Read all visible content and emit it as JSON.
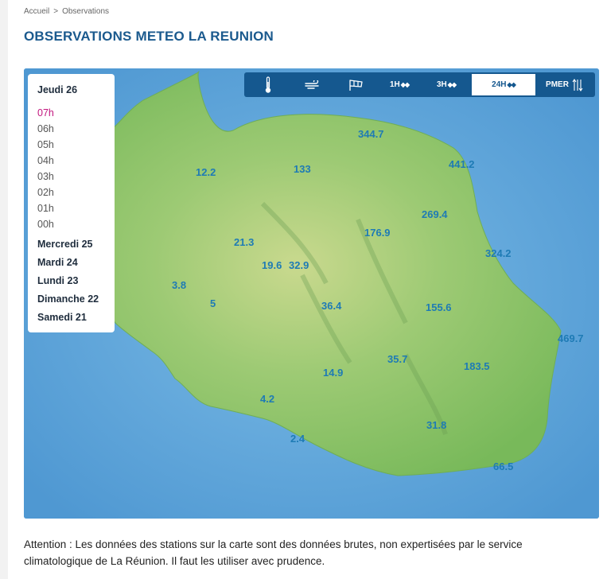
{
  "breadcrumb": {
    "home": "Accueil",
    "separator": ">",
    "current": "Observations"
  },
  "page_title": "OBSERVATIONS METEO LA REUNION",
  "time_panel": {
    "current_day": "Jeudi 26",
    "hours": [
      "07h",
      "06h",
      "05h",
      "04h",
      "03h",
      "02h",
      "01h",
      "00h"
    ],
    "active_hour": "07h",
    "previous_days": [
      "Mercredi 25",
      "Mardi 24",
      "Lundi 23",
      "Dimanche 22",
      "Samedi 21"
    ]
  },
  "toolbar": {
    "buttons": [
      {
        "id": "temperature",
        "icon": "thermometer-icon",
        "label": ""
      },
      {
        "id": "wind",
        "icon": "wind-icon",
        "label": ""
      },
      {
        "id": "gust",
        "icon": "wind-sock-icon",
        "label": ""
      },
      {
        "id": "rain1h",
        "icon": "raindrops-icon",
        "label": "1H"
      },
      {
        "id": "rain3h",
        "icon": "raindrops-icon",
        "label": "3H"
      },
      {
        "id": "rain24h",
        "icon": "raindrops-icon",
        "label": "24H"
      },
      {
        "id": "pmer",
        "icon": "pressure-icon",
        "label": "PMER"
      }
    ],
    "active": "rain24h"
  },
  "stations": [
    {
      "value": "344.7"
    },
    {
      "value": "12.2"
    },
    {
      "value": "133"
    },
    {
      "value": "441.2"
    },
    {
      "value": "269.4"
    },
    {
      "value": "176.9"
    },
    {
      "value": "21.3"
    },
    {
      "value": "324.2"
    },
    {
      "value": "19.6"
    },
    {
      "value": "32.9"
    },
    {
      "value": "3.8"
    },
    {
      "value": "5"
    },
    {
      "value": "36.4"
    },
    {
      "value": "155.6"
    },
    {
      "value": "469.7"
    },
    {
      "value": "35.7"
    },
    {
      "value": "183.5"
    },
    {
      "value": "14.9"
    },
    {
      "value": "4.2"
    },
    {
      "value": "31.8"
    },
    {
      "value": "2.4"
    },
    {
      "value": "66.5"
    }
  ],
  "colors": {
    "sea": "#5fa6d9",
    "land": "#8cc46a",
    "value_text": "#1e7bb5",
    "active_hour": "#c2177e",
    "toolbar": "#15588f"
  },
  "disclaimer": "Attention : Les données des stations sur la carte sont des données brutes, non expertisées par le service climatologique de La Réunion. Il faut les utiliser avec prudence."
}
